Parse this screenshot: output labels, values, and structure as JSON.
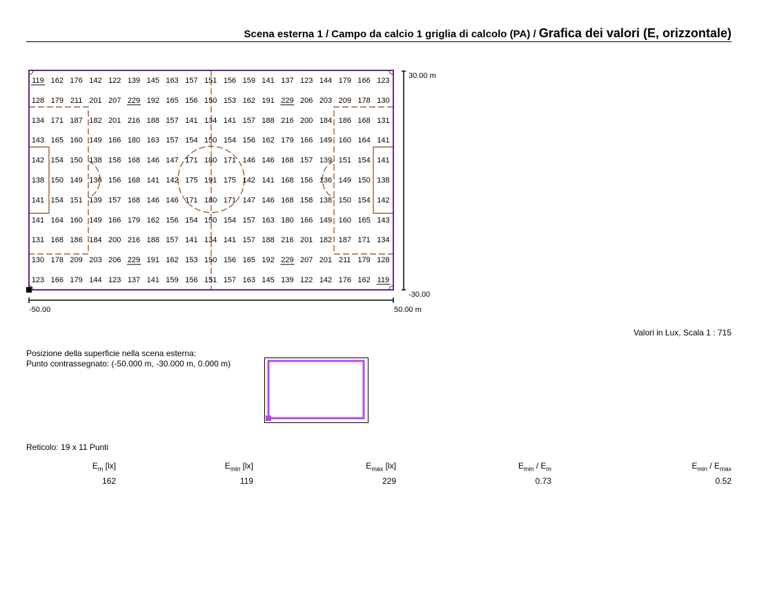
{
  "header": {
    "title_part1": "Scena esterna 1 / Campo da calcio 1 griglia di calcolo (PA) / ",
    "title_part2": "Grafica dei valori (E, orizzontale)"
  },
  "grid": {
    "rows": [
      [
        119,
        162,
        176,
        142,
        122,
        139,
        145,
        163,
        157,
        151,
        156,
        159,
        141,
        137,
        123,
        144,
        179,
        166,
        123
      ],
      [
        128,
        179,
        211,
        201,
        207,
        229,
        192,
        165,
        156,
        150,
        153,
        162,
        191,
        229,
        206,
        203,
        209,
        178,
        130
      ],
      [
        134,
        171,
        187,
        182,
        201,
        216,
        188,
        157,
        141,
        134,
        141,
        157,
        188,
        216,
        200,
        184,
        186,
        168,
        131
      ],
      [
        143,
        165,
        160,
        149,
        166,
        180,
        163,
        157,
        154,
        150,
        154,
        156,
        162,
        179,
        166,
        149,
        160,
        164,
        141
      ],
      [
        142,
        154,
        150,
        138,
        158,
        168,
        146,
        147,
        171,
        180,
        171,
        146,
        146,
        168,
        157,
        139,
        151,
        154,
        141
      ],
      [
        138,
        150,
        149,
        136,
        156,
        168,
        141,
        142,
        175,
        191,
        175,
        142,
        141,
        168,
        156,
        136,
        149,
        150,
        138
      ],
      [
        141,
        154,
        151,
        139,
        157,
        168,
        146,
        146,
        171,
        180,
        171,
        147,
        146,
        168,
        158,
        138,
        150,
        154,
        142
      ],
      [
        141,
        164,
        160,
        149,
        166,
        179,
        162,
        156,
        154,
        150,
        154,
        157,
        163,
        180,
        166,
        149,
        160,
        165,
        143
      ],
      [
        131,
        168,
        186,
        184,
        200,
        216,
        188,
        157,
        141,
        134,
        141,
        157,
        188,
        216,
        201,
        182,
        187,
        171,
        134
      ],
      [
        130,
        178,
        209,
        203,
        206,
        229,
        191,
        162,
        153,
        150,
        156,
        165,
        192,
        229,
        207,
        201,
        211,
        179,
        128
      ],
      [
        123,
        166,
        179,
        144,
        123,
        137,
        141,
        159,
        156,
        151,
        157,
        163,
        145,
        139,
        122,
        142,
        176,
        162,
        119
      ]
    ],
    "underlined": [
      [
        0,
        0
      ],
      [
        1,
        5
      ],
      [
        1,
        13
      ],
      [
        9,
        5
      ],
      [
        9,
        13
      ],
      [
        10,
        18
      ]
    ]
  },
  "axes": {
    "y_top": "30.00 m",
    "y_bottom": "-30.00",
    "x_left": "-50.00",
    "x_right": "50.00 m"
  },
  "scale_text": "Valori in Lux, Scala 1 : 715",
  "position": {
    "line1": "Posizione della superficie nella scena esterna:",
    "line2": "Punto contrassegnato: (-50.000 m, -30.000 m, 0.000 m)"
  },
  "reticolo": "Reticolo: 19 x 11 Punti",
  "stats": {
    "em": {
      "base": "E",
      "sub": "m",
      "unit": " [lx]",
      "value": "162"
    },
    "emin": {
      "base": "E",
      "sub": "min",
      "unit": " [lx]",
      "value": "119"
    },
    "emax": {
      "base": "E",
      "sub": "max",
      "unit": " [lx]",
      "value": "229"
    },
    "ratio1": {
      "a": "E",
      "asub": "min",
      "b": " / E",
      "bsub": "m",
      "value": "0.73"
    },
    "ratio2": {
      "a": "E",
      "asub": "min",
      "b": " / E",
      "bsub": "max",
      "value": "0.52"
    }
  },
  "colors": {
    "outline": "#5b2a8a",
    "lines": "#8b4513",
    "thumb": "#bb44ee"
  }
}
